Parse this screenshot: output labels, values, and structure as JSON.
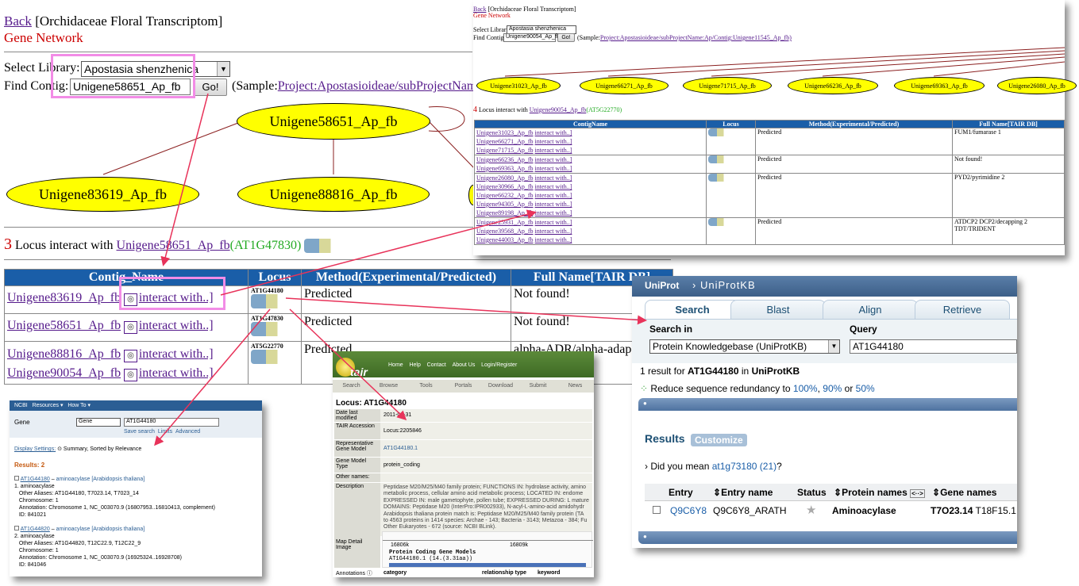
{
  "main": {
    "back": "Back",
    "title": "[Orchidaceae Floral Transcriptom]",
    "subtitle": "Gene Network",
    "select_label": "Select Library:",
    "library": "Apostasia shenzhenica",
    "find_label": "Find Contig:",
    "contig_value": "Unigene58651_Ap_fb",
    "go": "Go!",
    "sample_prefix": "(Sample:",
    "sample_link": "Project:Apostasioideae/subProjectNam",
    "nodes": [
      "Unigene58651_Ap_fb",
      "Unigene83619_Ap_fb",
      "Unigene88816_Ap_fb"
    ],
    "locus_count": "3",
    "locus_text": "Locus interact with",
    "locus_link": "Unigene58651_Ap_fb",
    "locus_agi": "(AT1G47830)",
    "table": {
      "headers": [
        "Contig_Name",
        "Locus",
        "Method(Experimental/Predicted)",
        "Full Name[TAIR DB]"
      ],
      "interact": "interact with..]",
      "rows": [
        {
          "contigs": [
            "Unigene83619_Ap_fb"
          ],
          "locus": "AT1G44180",
          "method": "Predicted",
          "full": "Not found!"
        },
        {
          "contigs": [
            "Unigene58651_Ap_fb"
          ],
          "locus": "AT1G47830",
          "method": "Predicted",
          "full": "Not found!"
        },
        {
          "contigs": [
            "Unigene88816_Ap_fb",
            "Unigene90054_Ap_fb"
          ],
          "locus": "AT5G22770",
          "method": "Predicted",
          "full": "alpha-ADR/alpha-adap"
        }
      ]
    }
  },
  "tr": {
    "back": "Back",
    "title": "[Orchidaceae Floral Transcriptom]",
    "subtitle": "Gene Network",
    "select_label": "Select Library:",
    "library": "Apostasia shenzhenica",
    "find_label": "Find Contig:",
    "contig_value": "Unigene90054_Ap_fb",
    "go": "Go!",
    "sample_prefix": "(Sample:",
    "sample_link": "Project:Apostasioideae/subProjectName:Ap/Contig:Unigene11545_Ap_fb)",
    "nodes": [
      "Unigene31023_Ap_fb",
      "Unigene66271_Ap_fb",
      "Unigene71715_Ap_fb",
      "Unigene66236_Ap_fb",
      "Unigene69363_Ap_fb",
      "Unigene26080_Ap_fb"
    ],
    "locus_count": "4",
    "locus_text": "Locus interact with",
    "locus_link": "Unigene90054_Ap_fb",
    "locus_agi": "(AT5G22770)",
    "headers": [
      "ContigName",
      "Locus",
      "Method(Experimental/Predicted)",
      "Full Name[TAIR DB]"
    ],
    "interact": "interact with..]",
    "groups": [
      {
        "contigs": [
          "Unigene31023_Ap_fb",
          "Unigene66271_Ap_fb",
          "Unigene71715_Ap_fb"
        ],
        "method": "Predicted",
        "full": "FUM1/fumarase 1"
      },
      {
        "contigs": [
          "Unigene66236_Ap_fb",
          "Unigene69363_Ap_fb"
        ],
        "method": "Predicted",
        "full": "Not found!"
      },
      {
        "contigs": [
          "Unigene26080_Ap_fb",
          "Unigene30966_Ap_fb",
          "Unigene66232_Ap_fb",
          "Unigene94305_Ap_fb",
          "Unigene89198_Ap_fb"
        ],
        "method": "Predicted",
        "full": "PYD2/pyrimidine 2"
      },
      {
        "contigs": [
          "Unigene25931_Ap_fb",
          "Unigene39568_Ap_fb",
          "Unigene44003_Ap_fb"
        ],
        "method": "Predicted",
        "full": "ATDCP2 DCP2/decapping 2 TDT/TRIDENT"
      }
    ]
  },
  "ncbi": {
    "logo": "NCBI",
    "resources": "Resources",
    "howto": "How To",
    "gene_label": "Gene",
    "db": "Gene",
    "query": "AT1G44180",
    "save": "Save search",
    "limits": "Limits",
    "advanced": "Advanced",
    "display": "Display Settings:",
    "summary": "Summary, Sorted by Relevance",
    "results": "Results: 2",
    "items": [
      {
        "num": "1.",
        "title": "AT1G44180",
        "desc": "aminoacylase [Arabidopsis thaliana]",
        "name": "aminoacylase",
        "aliases": "Other Aliases: AT1G44180, T7023.14, T7023_14",
        "chrom": "Chromosome: 1",
        "annot": "Annotation: Chromosome 1, NC_003070.9 (16807953..16810413, complement)",
        "id": "ID: 841021"
      },
      {
        "num": "2.",
        "title": "AT1G44820",
        "desc": "aminoacylase [Arabidopsis thaliana]",
        "name": "aminoacylase",
        "aliases": "Other Aliases: AT1G44820, T12C22.9, T12C22_9",
        "chrom": "Chromosome: 1",
        "annot": "Annotation: Chromosome 1, NC_003070.9 (16925324..16928708)",
        "id": "ID: 841046"
      }
    ]
  },
  "tair": {
    "logo": "tair",
    "topnav": [
      "Home",
      "Help",
      "Contact",
      "About Us",
      "Login/Register"
    ],
    "nav": [
      "Search",
      "Browse",
      "Tools",
      "Portals",
      "Download",
      "Submit",
      "News"
    ],
    "locus_title": "Locus: AT1G44180",
    "rows": [
      {
        "k": "Date last modified",
        "v": "2011-01-31"
      },
      {
        "k": "TAIR Accession",
        "v": "Locus:2205846"
      },
      {
        "k": "Representative Gene Model",
        "v": "AT1G44180.1"
      },
      {
        "k": "Gene Model Type",
        "v": "protein_coding"
      },
      {
        "k": "Other names:",
        "v": ""
      },
      {
        "k": "Description",
        "v": "Peptidase M20/M25/M40 family protein; FUNCTIONS IN: hydrolase activity, amino metabolic process, cellular amino acid metabolic process; LOCATED IN: endome EXPRESSED IN: male gametophyte, pollen tube; EXPRESSED DURING: L mature DOMAINS: Peptidase M20 (InterPro:IPR002933), N-acyl-L-amino-acid amidohydr Arabidopsis thaliana protein match is: Peptidase M20/M25/M40 family protein (TA to 4563 proteins in 1414 species: Archae - 143; Bacteria - 3143; Metazoa - 384; Fu Other Eukaryotes - 672 (source: NCBI BLink)."
      }
    ],
    "map_label": "Map Detail Image",
    "map_left": "16806k",
    "map_right": "16809k",
    "map_title": "Protein Coding Gene Models",
    "map_model": "AT1G44180.1 (14.(3.31aa))",
    "ann_label": "Annotations",
    "ann_cols": [
      "category",
      "relationship type",
      "keyword"
    ]
  },
  "uni": {
    "logo": "UniProt",
    "crumb": "UniProtKB",
    "tabs": [
      "Search",
      "Blast",
      "Align",
      "Retrieve"
    ],
    "search_in": "Search in",
    "query_label": "Query",
    "db": "Protein Knowledgebase (UniProtKB)",
    "query": "AT1G44180",
    "result_prefix": "1 result for",
    "result_term": "AT1G44180",
    "result_mid": "in",
    "result_db": "UniProtKB",
    "reduce": "Reduce sequence redundancy to",
    "pct": [
      "100%",
      "90%",
      "50%"
    ],
    "or": "or",
    "results": "Results",
    "customize": "Customize",
    "mean_prefix": "› Did you mean",
    "mean_link": "at1g73180 (21)",
    "mean_suffix": "?",
    "cols": [
      "Entry",
      "Entry name",
      "Status",
      "Protein names",
      "Gene names"
    ],
    "row": {
      "entry": "Q9C6Y8",
      "name": "Q9C6Y8_ARATH",
      "protein": "Aminoacylase",
      "gene": "T7O23.14",
      "gene2": "T18F15.1"
    }
  },
  "colors": {
    "accent": "#f28ce6",
    "arrow": "#e8335a",
    "node": "#ffff00",
    "header": "#1a5ea8",
    "uniprot": "#4a72a5"
  }
}
